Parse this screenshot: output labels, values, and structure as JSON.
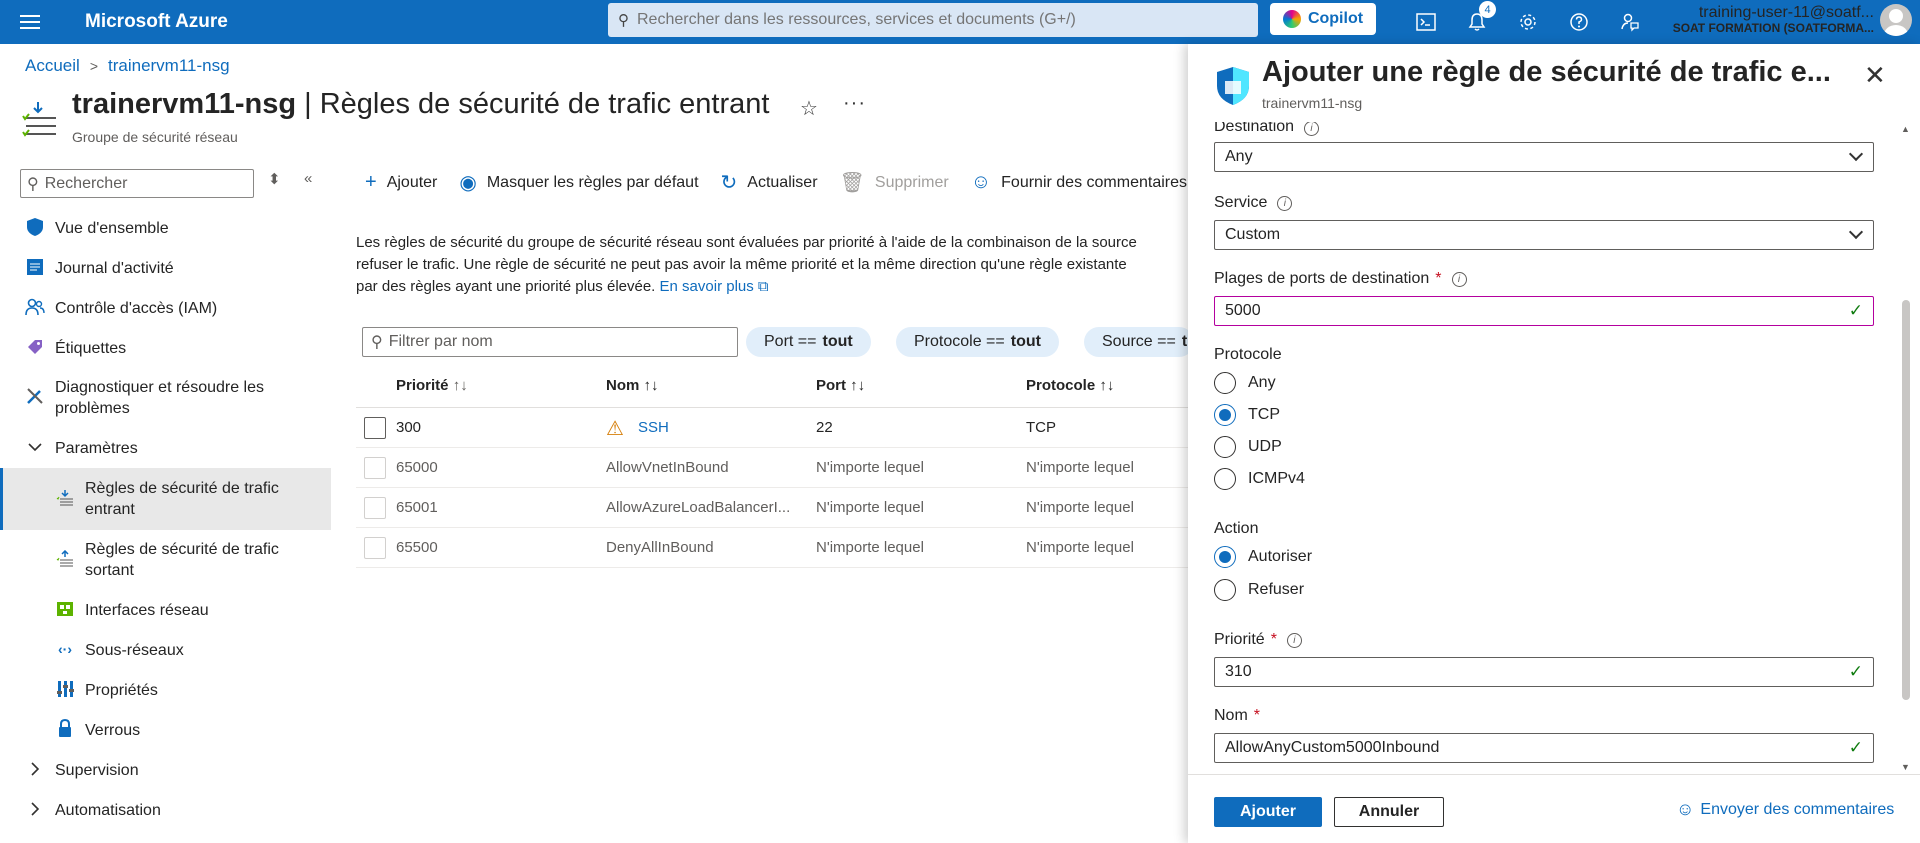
{
  "topbar": {
    "brand": "Microsoft Azure",
    "search_placeholder": "Rechercher dans les ressources, services et documents (G+/)",
    "copilot_label": "Copilot",
    "notification_count": "4",
    "user": "training-user-11@soatf...",
    "org": "SOAT FORMATION (SOATFORMA..."
  },
  "breadcrumb": {
    "home": "Accueil",
    "current": "trainervm11-nsg"
  },
  "page": {
    "resource_name": "trainervm11-nsg",
    "title_rest": " | Règles de sécurité de trafic entrant",
    "subtitle": "Groupe de sécurité réseau"
  },
  "nav": {
    "search_placeholder": "Rechercher",
    "items": [
      {
        "label": "Vue d'ensemble",
        "icon": "shield-icon"
      },
      {
        "label": "Journal d'activité",
        "icon": "log-icon"
      },
      {
        "label": "Contrôle d'accès (IAM)",
        "icon": "people-icon"
      },
      {
        "label": "Étiquettes",
        "icon": "tag-icon"
      },
      {
        "label": "Diagnostiquer et résoudre les problèmes",
        "icon": "wrench-icon"
      },
      {
        "label": "Paramètres",
        "icon": "chevron-down-icon"
      },
      {
        "label": "Règles de sécurité de trafic entrant",
        "icon": "inbound-rules-icon"
      },
      {
        "label": "Règles de sécurité de trafic sortant",
        "icon": "outbound-rules-icon"
      },
      {
        "label": "Interfaces réseau",
        "icon": "nic-icon"
      },
      {
        "label": "Sous-réseaux",
        "icon": "subnet-icon"
      },
      {
        "label": "Propriétés",
        "icon": "properties-icon"
      },
      {
        "label": "Verrous",
        "icon": "lock-icon"
      },
      {
        "label": "Supervision",
        "icon": "chevron-right-icon"
      },
      {
        "label": "Automatisation",
        "icon": "chevron-right-icon"
      }
    ]
  },
  "toolbar": {
    "add": "Ajouter",
    "hide_default": "Masquer les règles par défaut",
    "refresh": "Actualiser",
    "delete": "Supprimer",
    "feedback": "Fournir des commentaires"
  },
  "description": {
    "line1": "Les règles de sécurité du groupe de sécurité réseau sont évaluées par priorité à l'aide de la combinaison de la source",
    "line2": "refuser le trafic. Une règle de sécurité ne peut pas avoir la même priorité et la même direction qu'une règle existante",
    "line3": "par des règles ayant une priorité plus élevée.",
    "learn_more": "En savoir plus"
  },
  "filters": {
    "name_placeholder": "Filtrer par nom",
    "port_key": "Port ==",
    "port_val": "tout",
    "protocol_key": "Protocole ==",
    "protocol_val": "tout",
    "source_key": "Source ==",
    "source_val": "t"
  },
  "table": {
    "headers": {
      "priority": "Priorité",
      "name": "Nom",
      "port": "Port",
      "protocol": "Protocole"
    },
    "rows": [
      {
        "priority": "300",
        "name": "SSH",
        "port": "22",
        "protocol": "TCP"
      },
      {
        "priority": "65000",
        "name": "AllowVnetInBound",
        "port": "N'importe lequel",
        "protocol": "N'importe lequel"
      },
      {
        "priority": "65001",
        "name": "AllowAzureLoadBalancerI...",
        "port": "N'importe lequel",
        "protocol": "N'importe lequel"
      },
      {
        "priority": "65500",
        "name": "DenyAllInBound",
        "port": "N'importe lequel",
        "protocol": "N'importe lequel"
      }
    ]
  },
  "panel": {
    "title": "Ajouter une règle de sécurité de trafic e...",
    "subtitle": "trainervm11-nsg",
    "destination_label": "Destination",
    "destination_value": "Any",
    "service_label": "Service",
    "service_value": "Custom",
    "ports_label": "Plages de ports de destination",
    "ports_value": "5000",
    "protocol_label": "Protocole",
    "protocol_options": [
      "Any",
      "TCP",
      "UDP",
      "ICMPv4"
    ],
    "protocol_selected": "TCP",
    "action_label": "Action",
    "action_options": [
      "Autoriser",
      "Refuser"
    ],
    "action_selected": "Autoriser",
    "priority_label": "Priorité",
    "priority_value": "310",
    "name_label": "Nom",
    "name_value": "AllowAnyCustom5000Inbound",
    "required_mark": "*",
    "add_button": "Ajouter",
    "cancel_button": "Annuler",
    "feedback_link": "Envoyer des commentaires"
  },
  "colors": {
    "accent": "#0f6cbd",
    "topbar": "#0f6cbd",
    "valid": "#107c10",
    "warning": "#d67f0b"
  }
}
